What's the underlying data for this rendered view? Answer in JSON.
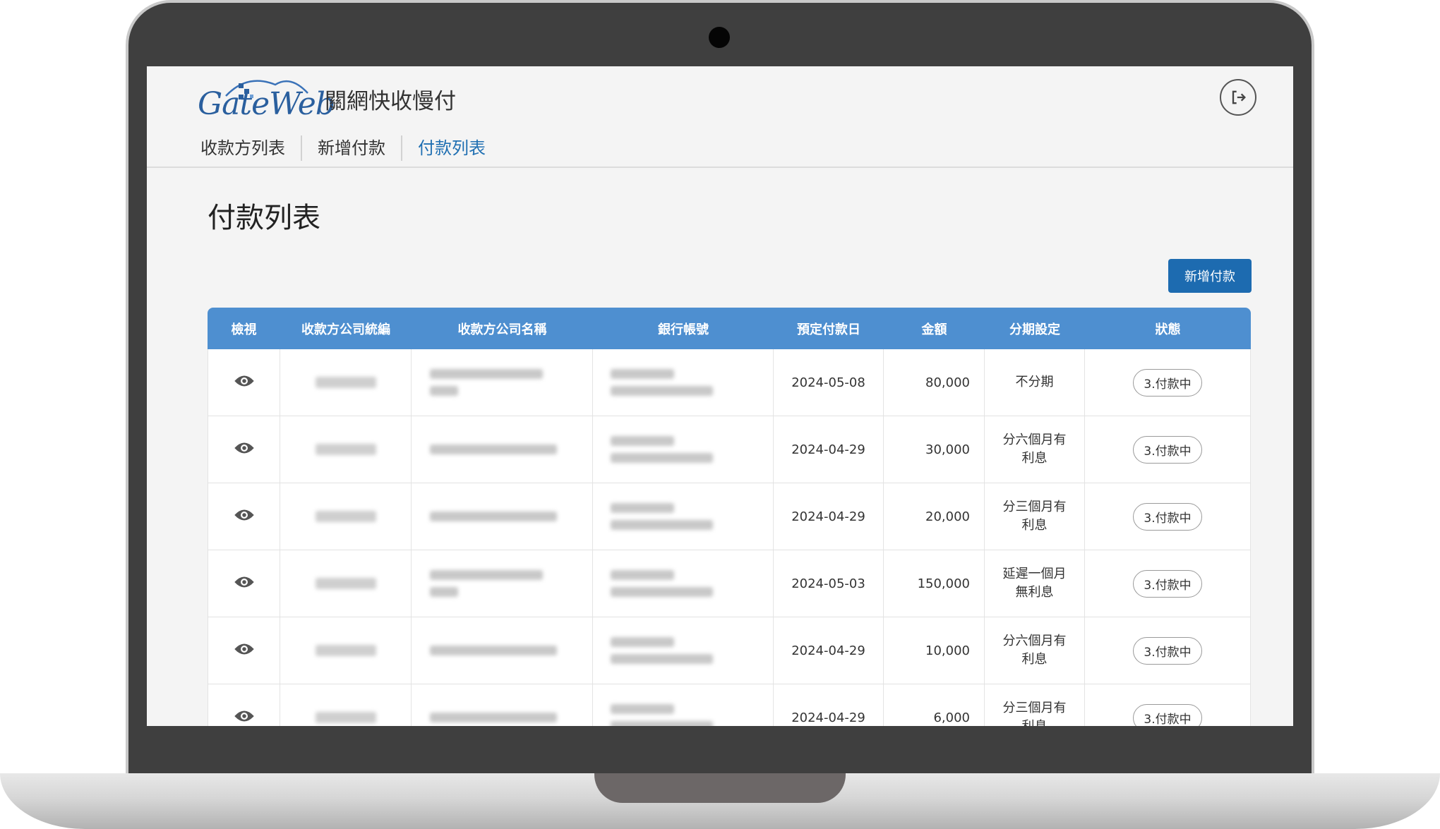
{
  "app": {
    "logo_text": "GateWeb",
    "name": "關網快收慢付"
  },
  "nav": [
    {
      "label": "收款方列表"
    },
    {
      "label": "新增付款"
    },
    {
      "label": "付款列表"
    }
  ],
  "page": {
    "title": "付款列表",
    "add_button": "新增付款"
  },
  "colors": {
    "accent": "#1d6bb0",
    "table_header": "#4e8fd0",
    "active_nav": "#1f6fb2"
  },
  "table": {
    "headers": [
      "檢視",
      "收款方公司統編",
      "收款方公司名稱",
      "銀行帳號",
      "預定付款日",
      "金額",
      "分期設定",
      "狀態"
    ],
    "rows": [
      {
        "date": "2024-05-08",
        "amount": "80,000",
        "plan": [
          "不分期"
        ],
        "status": "3.付款中"
      },
      {
        "date": "2024-04-29",
        "amount": "30,000",
        "plan": [
          "分六個月有",
          "利息"
        ],
        "status": "3.付款中"
      },
      {
        "date": "2024-04-29",
        "amount": "20,000",
        "plan": [
          "分三個月有",
          "利息"
        ],
        "status": "3.付款中"
      },
      {
        "date": "2024-05-03",
        "amount": "150,000",
        "plan": [
          "延遲一個月",
          "無利息"
        ],
        "status": "3.付款中"
      },
      {
        "date": "2024-04-29",
        "amount": "10,000",
        "plan": [
          "分六個月有",
          "利息"
        ],
        "status": "3.付款中"
      },
      {
        "date": "2024-04-29",
        "amount": "6,000",
        "plan": [
          "分三個月有",
          "利息"
        ],
        "status": "3.付款中"
      }
    ]
  },
  "icons": {
    "view": "eye-icon",
    "logout": "logout-icon"
  }
}
